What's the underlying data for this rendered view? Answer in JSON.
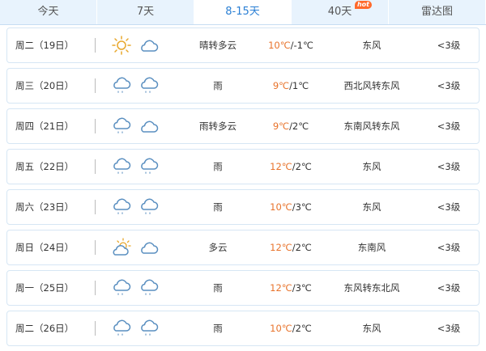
{
  "tabs": [
    {
      "label": "今天",
      "width": 120
    },
    {
      "label": "7天",
      "width": 120
    },
    {
      "label": "8-15天",
      "width": 120,
      "active": true
    },
    {
      "label": "40天",
      "width": 120,
      "badge": "hot"
    },
    {
      "label": "雷达图",
      "width": 120
    }
  ],
  "days": [
    {
      "day": "周二（19日）",
      "icons": [
        "sun-icon",
        "cloud-icon"
      ],
      "cond": "晴转多云",
      "hi": "10℃",
      "lo": "/-1℃",
      "wind": "东风",
      "level": "<3级"
    },
    {
      "day": "周三（20日）",
      "icons": [
        "rain-icon",
        "rain-icon"
      ],
      "cond": "雨",
      "hi": "9℃",
      "lo": "/1℃",
      "wind": "西北风转东风",
      "level": "<3级"
    },
    {
      "day": "周四（21日）",
      "icons": [
        "rain-icon",
        "cloud-icon"
      ],
      "cond": "雨转多云",
      "hi": "9℃",
      "lo": "/2℃",
      "wind": "东南风转东风",
      "level": "<3级"
    },
    {
      "day": "周五（22日）",
      "icons": [
        "rain-icon",
        "rain-icon"
      ],
      "cond": "雨",
      "hi": "12℃",
      "lo": "/2℃",
      "wind": "东风",
      "level": "<3级"
    },
    {
      "day": "周六（23日）",
      "icons": [
        "rain-icon",
        "rain-icon"
      ],
      "cond": "雨",
      "hi": "10℃",
      "lo": "/3℃",
      "wind": "东风",
      "level": "<3级"
    },
    {
      "day": "周日（24日）",
      "icons": [
        "partly-cloudy-icon",
        "cloud-icon"
      ],
      "cond": "多云",
      "hi": "12℃",
      "lo": "/2℃",
      "wind": "东南风",
      "level": "<3级"
    },
    {
      "day": "周一（25日）",
      "icons": [
        "rain-icon",
        "rain-icon"
      ],
      "cond": "雨",
      "hi": "12℃",
      "lo": "/3℃",
      "wind": "东风转东北风",
      "level": "<3级"
    },
    {
      "day": "周二（26日）",
      "icons": [
        "rain-icon",
        "rain-icon"
      ],
      "cond": "雨",
      "hi": "10℃",
      "lo": "/2℃",
      "wind": "东风",
      "level": "<3级"
    }
  ],
  "colors": {
    "accent": "#2a7fd4",
    "temp_high": "#e8732b",
    "tab_bg": "#e8f3fd",
    "icon_stroke": "#5a8fc0"
  }
}
